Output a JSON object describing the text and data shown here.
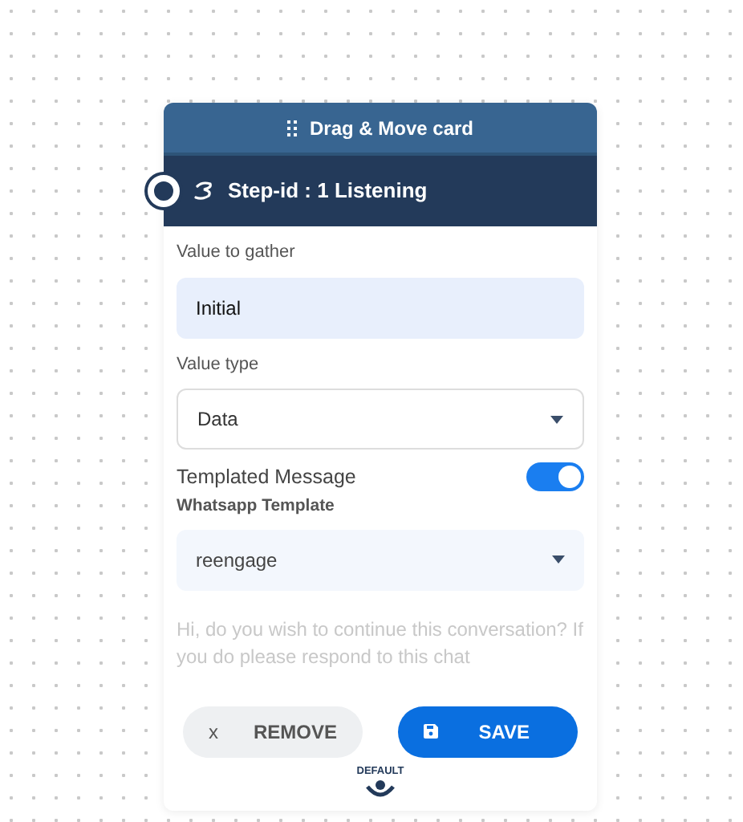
{
  "card": {
    "drag_handle": "Drag & Move card",
    "step_title": "Step-id : 1 Listening",
    "fields": [
      {
        "kind": "text",
        "label": "Value to gather",
        "value": "Initial"
      },
      {
        "kind": "select",
        "label": "Value type",
        "value": "Data"
      }
    ],
    "templated_message": {
      "label": "Templated Message",
      "on": true
    },
    "template_select": {
      "label": "Whatsapp Template",
      "value": "reengage"
    },
    "message": {
      "placeholder": "Hi, do you wish to continue this conversation? If you do please respond to this chat"
    },
    "buttons": [
      {
        "kind": "remove",
        "icon": "x",
        "label": "REMOVE"
      },
      {
        "kind": "save",
        "label": "SAVE"
      }
    ],
    "output_port": {
      "label": "DEFAULT"
    }
  }
}
